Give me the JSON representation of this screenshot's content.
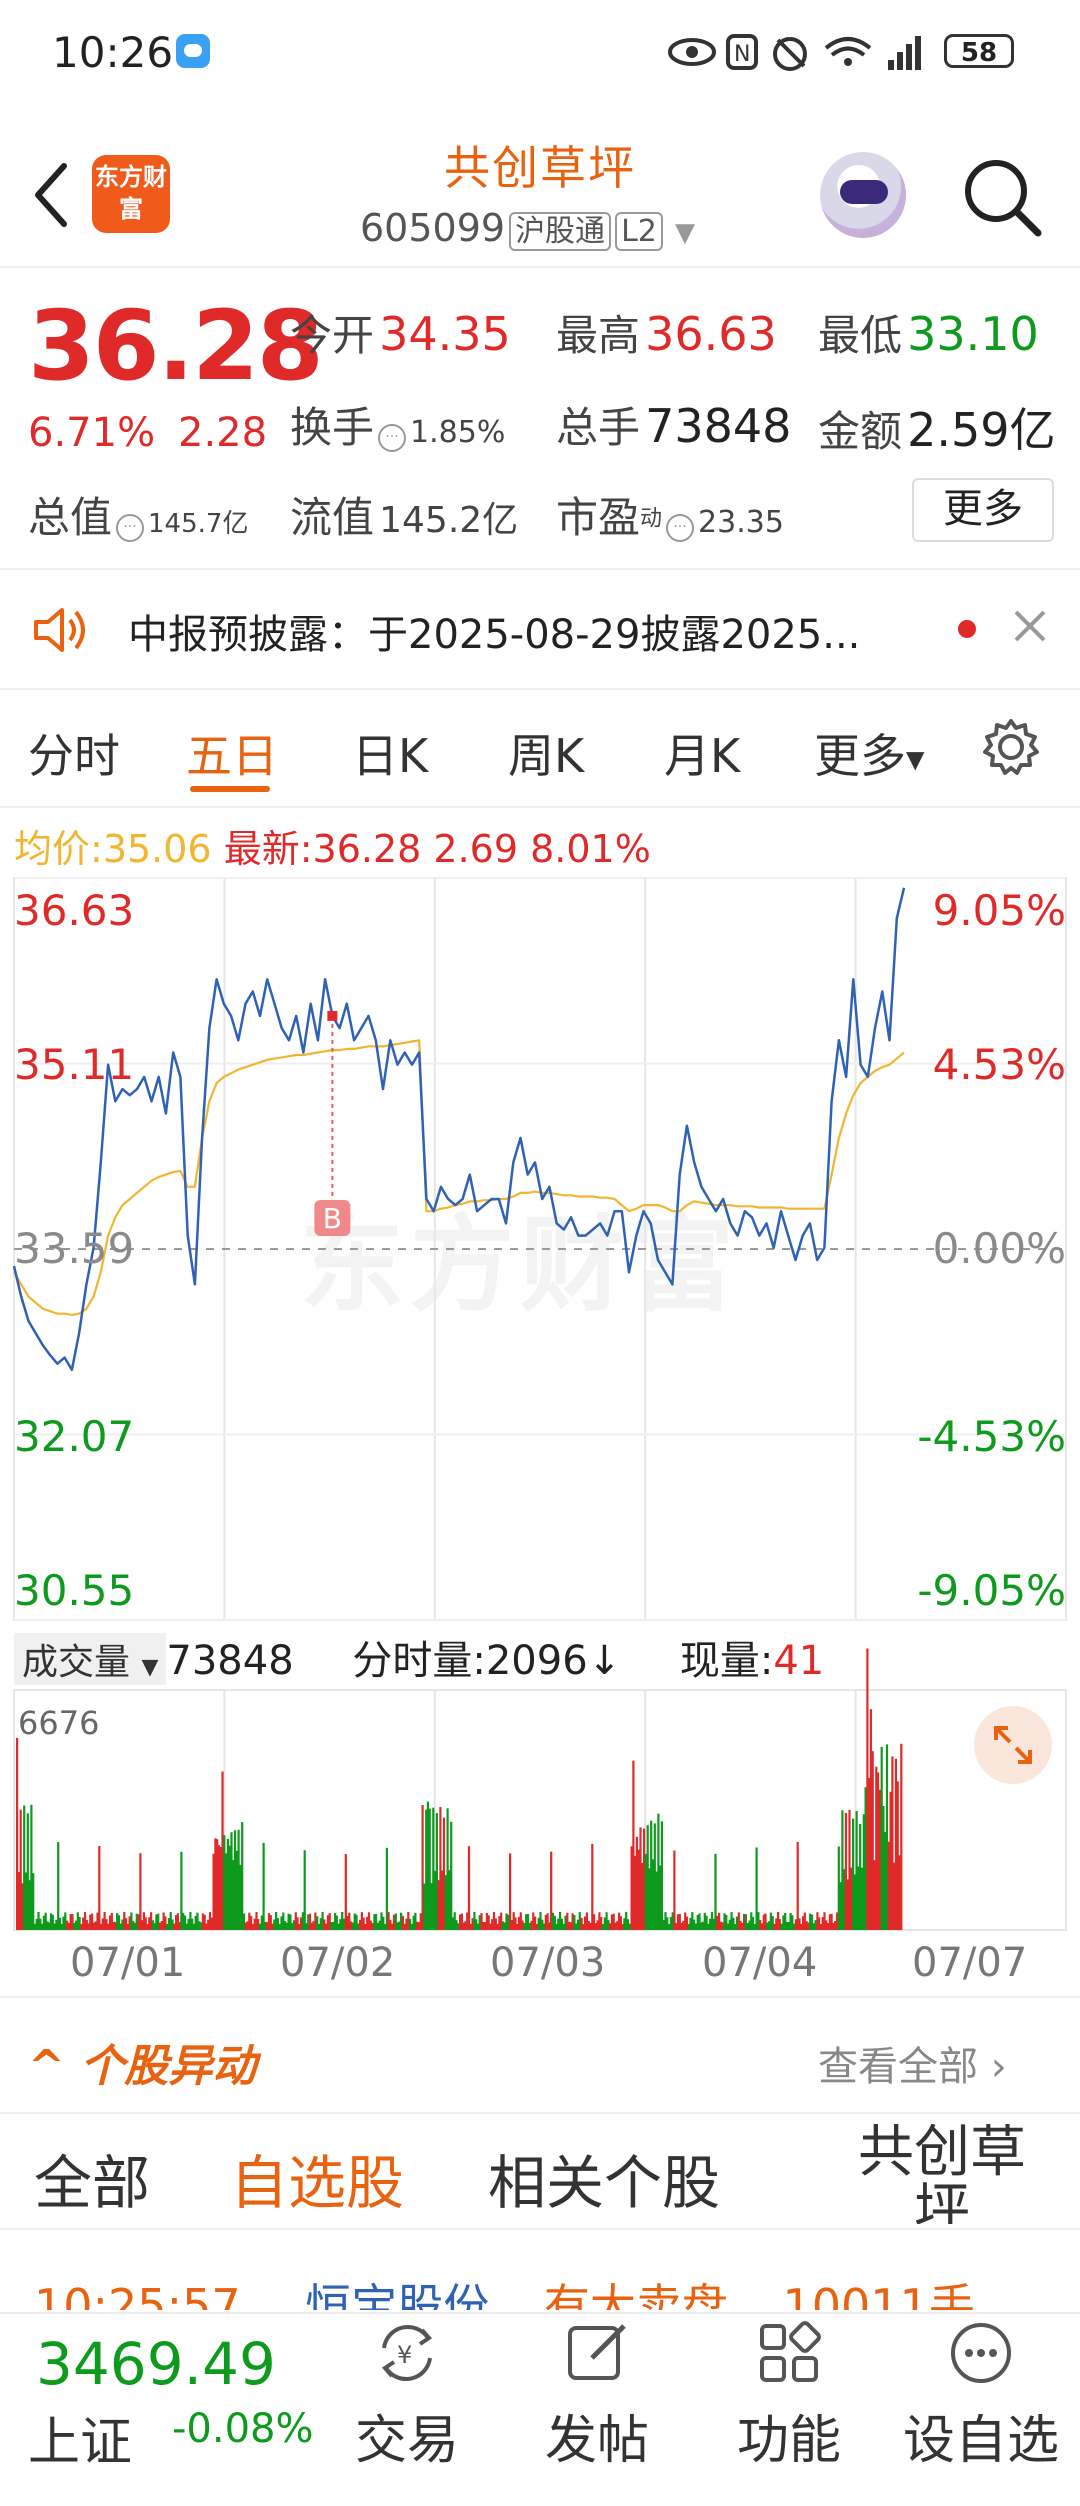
{
  "status_bar": {
    "time": "10:26",
    "battery": "58"
  },
  "header": {
    "logo_text": "东方财富",
    "stock_name": "共创草坪",
    "stock_code": "605099",
    "tag1": "沪股通",
    "tag2": "L2"
  },
  "quote": {
    "price": "36.28",
    "change_pct": "6.71%",
    "change_amt": "2.28",
    "open_label": "今开",
    "open": "34.35",
    "high_label": "最高",
    "high": "36.63",
    "low_label": "最低",
    "low": "33.10",
    "turnover_label": "换手",
    "turnover": "1.85%",
    "volume_label": "总手",
    "volume": "73848",
    "amount_label": "金额",
    "amount": "2.59亿",
    "mcap_label": "总值",
    "mcap": "145.7亿",
    "float_label": "流值",
    "float": "145.2亿",
    "pe_label": "市盈",
    "pe_sup": "动",
    "pe": "23.35",
    "more": "更多"
  },
  "notice": {
    "text": "中报预披露：于2025-08-29披露2025..."
  },
  "tabs": {
    "items": [
      "分时",
      "五日",
      "日K",
      "周K",
      "月K",
      "更多"
    ],
    "active": "五日"
  },
  "chart_header": {
    "avg_label": "均价:",
    "avg": "35.06",
    "latest_label": "最新:",
    "latest": "36.28",
    "change": "2.69",
    "pct": "8.01%"
  },
  "chart_data": {
    "type": "line",
    "title": "",
    "x": [
      "07/01",
      "07/02",
      "07/03",
      "07/04",
      "07/07"
    ],
    "y_ticks_left": [
      "36.63",
      "35.11",
      "33.59",
      "32.07",
      "30.55"
    ],
    "y_ticks_right": [
      "9.05%",
      "4.53%",
      "0.00%",
      "-4.53%",
      "-9.05%"
    ],
    "ylim": [
      30.55,
      36.63
    ],
    "prev_close": 33.59,
    "series": [
      {
        "values": [
          33.45,
          33.2,
          33.0,
          32.9,
          32.8,
          32.72,
          32.65,
          32.7,
          32.6,
          32.9,
          33.3,
          33.6,
          34.3,
          35.1,
          34.8,
          34.9,
          34.85,
          34.9,
          35.0,
          34.8,
          35.0,
          34.7,
          35.2,
          35.0,
          33.7,
          33.3,
          34.5,
          35.4,
          35.8,
          35.6,
          35.5,
          35.3,
          35.6,
          35.7,
          35.5,
          35.8,
          35.6,
          35.4,
          35.3,
          35.5,
          35.2,
          35.6,
          35.3,
          35.8,
          35.5,
          35.4,
          35.6,
          35.3,
          35.4,
          35.5,
          35.3,
          34.9,
          35.3,
          35.1,
          35.2,
          35.1,
          35.2,
          34.0,
          33.9,
          34.1,
          34.0,
          33.95,
          34.0,
          34.2,
          33.9,
          33.95,
          34.0,
          34.0,
          33.8,
          34.3,
          34.5,
          34.2,
          34.3,
          34.0,
          34.1,
          33.8,
          33.75,
          33.85,
          33.7,
          33.7,
          33.75,
          33.8,
          33.7,
          33.9,
          33.9,
          33.4,
          33.7,
          33.9,
          33.8,
          33.5,
          33.4,
          33.3,
          34.2,
          34.6,
          34.3,
          34.1,
          34.0,
          33.9,
          34.0,
          33.8,
          33.7,
          33.9,
          33.85,
          33.7,
          33.8,
          33.6,
          33.9,
          33.7,
          33.5,
          33.7,
          33.8,
          33.5,
          33.6,
          34.8,
          35.3,
          35.0,
          35.8,
          35.1,
          35.0,
          35.4,
          35.7,
          35.3,
          36.3,
          36.55
        ],
        "color": "#2f62b4"
      },
      {
        "values": [
          33.4,
          33.3,
          33.2,
          33.15,
          33.1,
          33.08,
          33.06,
          33.06,
          33.05,
          33.06,
          33.1,
          33.2,
          33.4,
          33.7,
          33.85,
          33.95,
          34.0,
          34.05,
          34.1,
          34.15,
          34.18,
          34.2,
          34.22,
          34.23,
          34.1,
          34.1,
          34.5,
          34.8,
          34.95,
          35.0,
          35.03,
          35.06,
          35.08,
          35.1,
          35.12,
          35.14,
          35.15,
          35.16,
          35.17,
          35.18,
          35.18,
          35.19,
          35.2,
          35.21,
          35.22,
          35.22,
          35.23,
          35.23,
          35.24,
          35.25,
          35.25,
          35.25,
          35.26,
          35.27,
          35.28,
          35.29,
          35.3,
          33.9,
          33.9,
          33.92,
          33.93,
          33.95,
          33.96,
          33.98,
          33.98,
          33.99,
          33.99,
          34.0,
          34.0,
          34.02,
          34.05,
          34.05,
          34.06,
          34.05,
          34.05,
          34.04,
          34.03,
          34.03,
          34.02,
          34.02,
          34.02,
          34.01,
          34.01,
          34.0,
          33.95,
          33.9,
          33.92,
          33.95,
          33.95,
          33.95,
          33.93,
          33.9,
          33.9,
          33.95,
          33.98,
          33.97,
          33.96,
          33.95,
          33.95,
          33.95,
          33.94,
          33.94,
          33.94,
          33.93,
          33.93,
          33.93,
          33.93,
          33.92,
          33.92,
          33.92,
          33.92,
          33.92,
          33.92,
          34.2,
          34.5,
          34.7,
          34.85,
          34.95,
          35.0,
          35.05,
          35.08,
          35.1,
          35.15,
          35.2
        ],
        "color": "#f2b531"
      }
    ]
  },
  "volume": {
    "dropdown": "成交量",
    "total": "73848",
    "tick_label": "分时量:",
    "tick": "2096",
    "tick_arrow": "↓",
    "now_label": "现量:",
    "now": "41",
    "max": "6676"
  },
  "watermark": "东方财富",
  "marker": "B",
  "anomaly": {
    "title": "个股异动",
    "view_all": "查看全部",
    "tabs": [
      "全部",
      "自选股",
      "相关个股",
      "共创草坪"
    ],
    "active": "自选股",
    "row_time": "10:25:57",
    "row_stock": "恒宝股份",
    "row_event": "有大卖盘",
    "row_amount": "10011手"
  },
  "bottom_nav": {
    "index_value": "3469.49",
    "index_name": "上证",
    "index_change": "-0.08%",
    "items": [
      "交易",
      "发帖",
      "功能",
      "设自选"
    ]
  }
}
